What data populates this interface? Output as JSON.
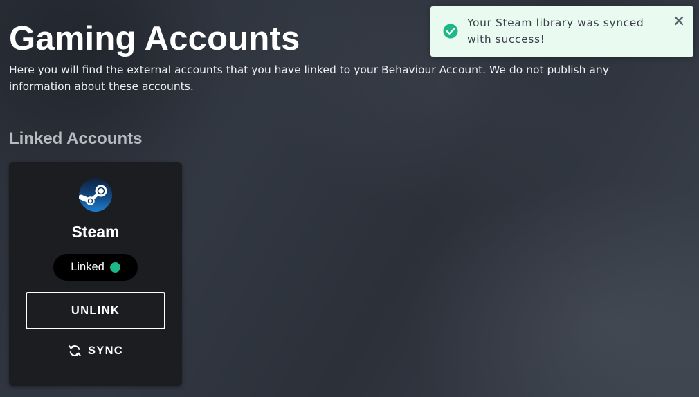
{
  "page": {
    "title": "Gaming Accounts",
    "description": "Here you will find the external accounts that you have linked to your Behaviour Account. We do not publish any information about these accounts."
  },
  "linked_accounts": {
    "section_title": "Linked Accounts",
    "accounts": [
      {
        "name": "Steam",
        "icon": "steam-logo-icon",
        "status": "Linked",
        "status_color": "#1cb887",
        "unlink_label": "UNLINK",
        "sync_label": "SYNC",
        "sync_icon": "sync-icon"
      }
    ]
  },
  "toast": {
    "message": "Your Steam library was synced with success!",
    "icon": "check-circle-icon",
    "close_icon": "close-icon",
    "accent_color": "#1cb887",
    "background_color": "#e9faf1"
  },
  "colors": {
    "card_background": "#1c1d20",
    "section_title": "#b7bbc2",
    "steam_blue": "#1b63a8"
  }
}
